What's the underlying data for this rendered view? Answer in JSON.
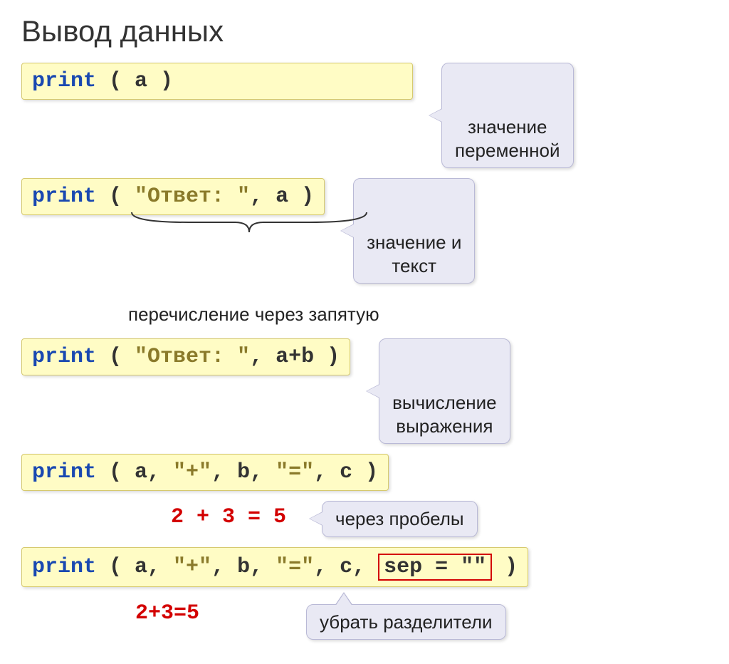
{
  "title": "Вывод данных",
  "rows": [
    {
      "code": {
        "kw": "print",
        "rest": " ( a )"
      },
      "callout": "значение\nпеременной"
    },
    {
      "code": {
        "kw": "print",
        "prefix": " ( ",
        "str": "\"Ответ: \"",
        "rest": ", a )"
      },
      "callout": "значение и\nтекст",
      "note": "перечисление через запятую"
    },
    {
      "code": {
        "kw": "print",
        "prefix": " ( ",
        "str": "\"Ответ: \"",
        "rest": ", a+b )"
      },
      "callout": "вычисление\nвыражения"
    },
    {
      "code_multi": [
        {
          "t": "kw",
          "v": "print"
        },
        {
          "t": "pn",
          "v": " ( a, "
        },
        {
          "t": "str",
          "v": "\"+\""
        },
        {
          "t": "pn",
          "v": ", b, "
        },
        {
          "t": "str",
          "v": "\"=\""
        },
        {
          "t": "pn",
          "v": ", c )"
        }
      ],
      "output": "2 + 3 = 5",
      "callout_below": "через пробелы"
    },
    {
      "code_multi": [
        {
          "t": "kw",
          "v": "print"
        },
        {
          "t": "pn",
          "v": " ( a, "
        },
        {
          "t": "str",
          "v": "\"+\""
        },
        {
          "t": "pn",
          "v": ", b, "
        },
        {
          "t": "str",
          "v": "\"=\""
        },
        {
          "t": "pn",
          "v": ", c, "
        },
        {
          "t": "sep",
          "v": "sep = \"\""
        },
        {
          "t": "pn",
          "v": " )"
        }
      ],
      "output": "2+3=5",
      "callout_below": "убрать разделители"
    }
  ]
}
